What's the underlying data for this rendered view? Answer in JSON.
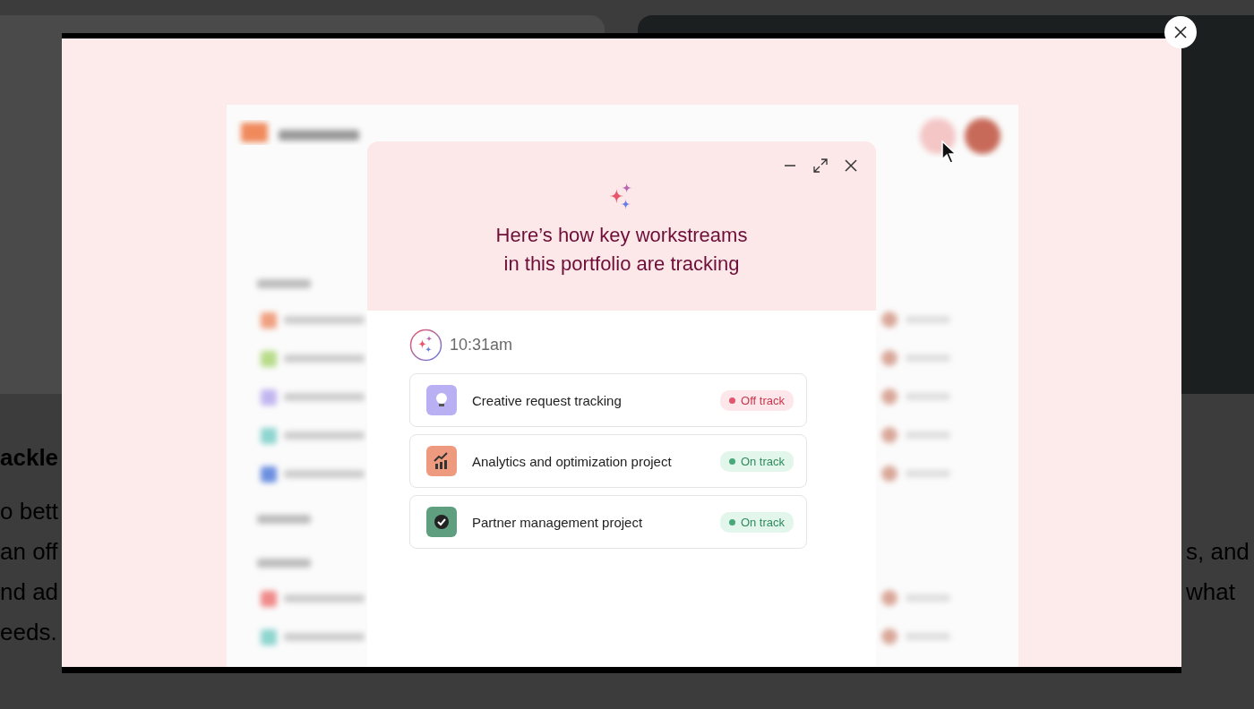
{
  "background_page": {
    "heading": "ackle",
    "left_lines": [
      "o bett",
      "an off",
      "nd ad",
      "eeds."
    ],
    "right_lines": [
      "s, and",
      "what"
    ]
  },
  "dialog": {
    "title_lines": [
      "Here’s how key workstreams",
      "in this portfolio are tracking"
    ],
    "timestamp": "10:31am",
    "workstreams": [
      {
        "name": "Creative request tracking",
        "kind": "bulb",
        "color": "#b9b0f4",
        "status": "Off track",
        "on_track": false
      },
      {
        "name": "Analytics and optimization project",
        "kind": "chart",
        "color": "#ee9a7f",
        "status": "On track",
        "on_track": true
      },
      {
        "name": "Partner management project",
        "kind": "check",
        "color": "#5f9f80",
        "status": "On track",
        "on_track": true
      }
    ]
  }
}
